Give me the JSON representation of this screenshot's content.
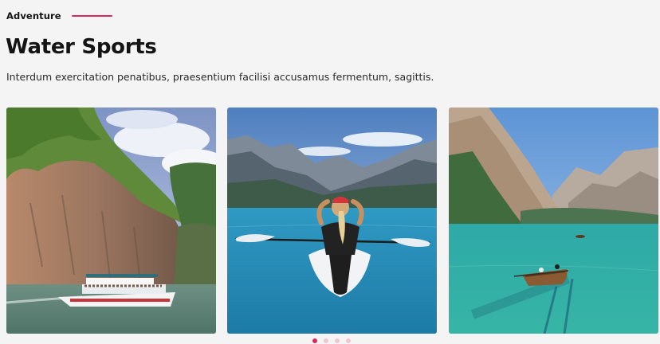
{
  "header": {
    "eyebrow": "Adventure",
    "title": "Water Sports",
    "subtitle": "Interdum exercitation penatibus, praesentium facilisi accusamus fermentum, sagittis."
  },
  "cards": [
    {
      "image": "boat-cliff-photo"
    },
    {
      "image": "kayak-mountain-lake-photo"
    },
    {
      "image": "rowboat-turquoise-lake-photo"
    }
  ],
  "pagination": {
    "total": 4,
    "active_index": 0
  },
  "colors": {
    "accent": "#d8295f",
    "dot_inactive": "#f1c6d4",
    "background": "#f4f4f4"
  }
}
